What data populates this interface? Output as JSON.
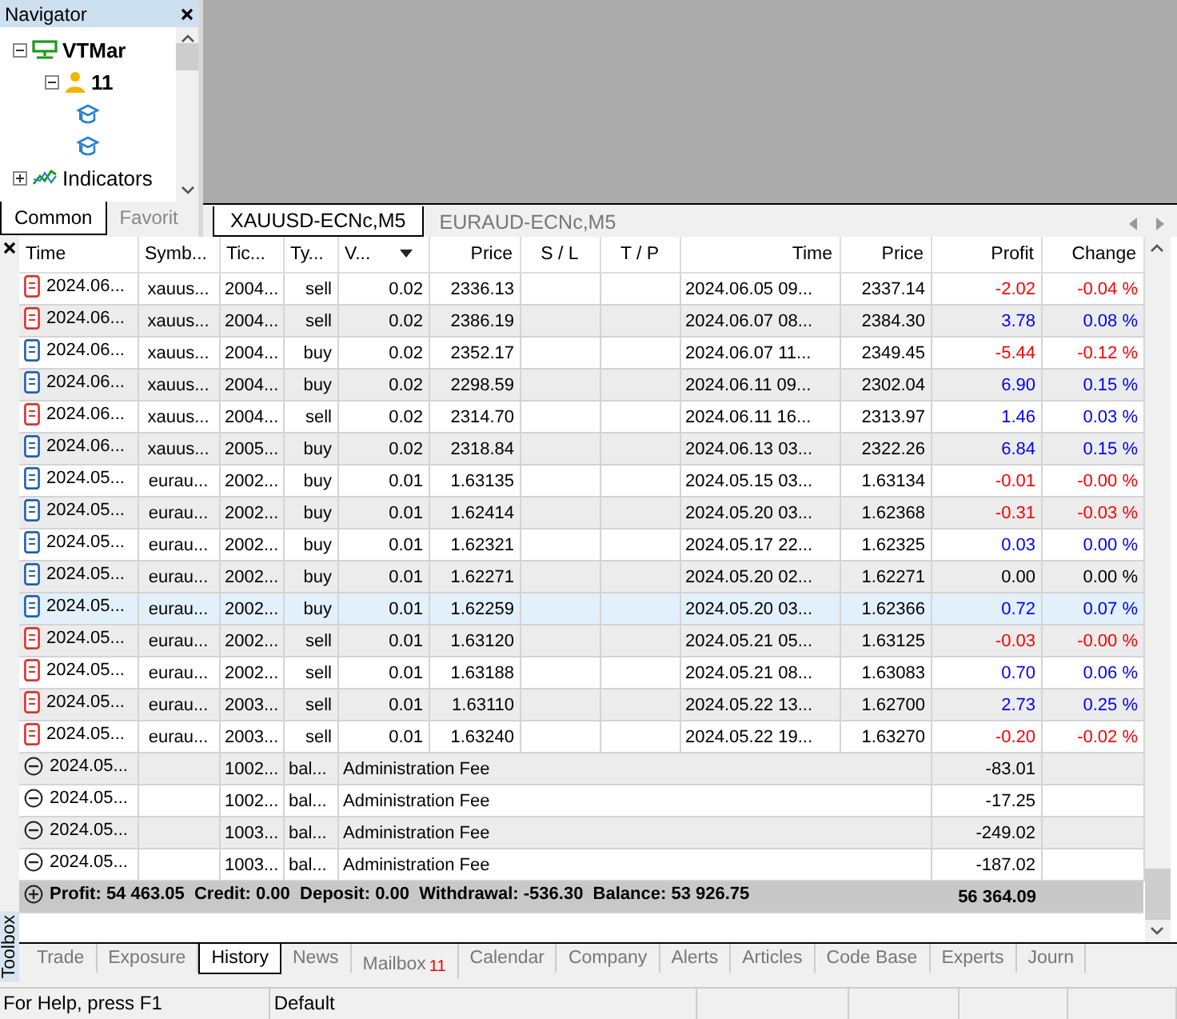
{
  "navigator": {
    "title": "Navigator",
    "tree": [
      {
        "label": "VTMar",
        "kind": "server",
        "expanded": true,
        "children": [
          {
            "label": "11",
            "kind": "account",
            "expanded": true,
            "children": [
              {
                "kind": "expert"
              },
              {
                "kind": "expert"
              }
            ]
          }
        ]
      },
      {
        "label": "Indicators",
        "kind": "indicators",
        "expanded": false
      }
    ],
    "tabs": [
      {
        "label": "Common",
        "selected": true
      },
      {
        "label": "Favorit",
        "selected": false
      }
    ]
  },
  "chart_tabs": [
    {
      "label": "XAUUSD-ECNc,M5",
      "selected": true
    },
    {
      "label": "EURAUD-ECNc,M5",
      "selected": false
    }
  ],
  "toolbox": {
    "label": "Toolbox",
    "columns": [
      {
        "label": "Time",
        "sorted": false
      },
      {
        "label": "Symb...",
        "sorted": false
      },
      {
        "label": "Tic...",
        "sorted": false
      },
      {
        "label": "Ty...",
        "sorted": false
      },
      {
        "label": "V...",
        "sorted": true
      },
      {
        "label": "Price",
        "sorted": false
      },
      {
        "label": "S / L",
        "sorted": false
      },
      {
        "label": "T / P",
        "sorted": false
      },
      {
        "label": "Time",
        "sorted": false
      },
      {
        "label": "Price",
        "sorted": false
      },
      {
        "label": "Profit",
        "sorted": false
      },
      {
        "label": "Change",
        "sorted": false
      }
    ],
    "rows": [
      {
        "kind": "sell",
        "selected": false,
        "time": "2024.06...",
        "symbol": "xauus...",
        "ticket": "2004...",
        "type": "sell",
        "volume": "0.02",
        "price": "2336.13",
        "close_time": "2024.06.05 09...",
        "close_price": "2337.14",
        "profit": "-2.02",
        "change": "-0.04 %",
        "color": "#ff0000"
      },
      {
        "kind": "sell",
        "selected": false,
        "time": "2024.06...",
        "symbol": "xauus...",
        "ticket": "2004...",
        "type": "sell",
        "volume": "0.02",
        "price": "2386.19",
        "close_time": "2024.06.07 08...",
        "close_price": "2384.30",
        "profit": "3.78",
        "change": "0.08 %",
        "color": "#0000ff"
      },
      {
        "kind": "buy",
        "selected": false,
        "time": "2024.06...",
        "symbol": "xauus...",
        "ticket": "2004...",
        "type": "buy",
        "volume": "0.02",
        "price": "2352.17",
        "close_time": "2024.06.07 11...",
        "close_price": "2349.45",
        "profit": "-5.44",
        "change": "-0.12 %",
        "color": "#ff0000"
      },
      {
        "kind": "buy",
        "selected": false,
        "time": "2024.06...",
        "symbol": "xauus...",
        "ticket": "2004...",
        "type": "buy",
        "volume": "0.02",
        "price": "2298.59",
        "close_time": "2024.06.11 09...",
        "close_price": "2302.04",
        "profit": "6.90",
        "change": "0.15 %",
        "color": "#0000ff"
      },
      {
        "kind": "sell",
        "selected": false,
        "time": "2024.06...",
        "symbol": "xauus...",
        "ticket": "2004...",
        "type": "sell",
        "volume": "0.02",
        "price": "2314.70",
        "close_time": "2024.06.11 16...",
        "close_price": "2313.97",
        "profit": "1.46",
        "change": "0.03 %",
        "color": "#0000ff"
      },
      {
        "kind": "buy",
        "selected": false,
        "time": "2024.06...",
        "symbol": "xauus...",
        "ticket": "2005...",
        "type": "buy",
        "volume": "0.02",
        "price": "2318.84",
        "close_time": "2024.06.13 03...",
        "close_price": "2322.26",
        "profit": "6.84",
        "change": "0.15 %",
        "color": "#0000ff"
      },
      {
        "kind": "buy",
        "selected": false,
        "time": "2024.05...",
        "symbol": "eurau...",
        "ticket": "2002...",
        "type": "buy",
        "volume": "0.01",
        "price": "1.63135",
        "close_time": "2024.05.15 03...",
        "close_price": "1.63134",
        "profit": "-0.01",
        "change": "-0.00 %",
        "color": "#ff0000"
      },
      {
        "kind": "buy",
        "selected": false,
        "time": "2024.05...",
        "symbol": "eurau...",
        "ticket": "2002...",
        "type": "buy",
        "volume": "0.01",
        "price": "1.62414",
        "close_time": "2024.05.20 03...",
        "close_price": "1.62368",
        "profit": "-0.31",
        "change": "-0.03 %",
        "color": "#ff0000"
      },
      {
        "kind": "buy",
        "selected": false,
        "time": "2024.05...",
        "symbol": "eurau...",
        "ticket": "2002...",
        "type": "buy",
        "volume": "0.01",
        "price": "1.62321",
        "close_time": "2024.05.17 22...",
        "close_price": "1.62325",
        "profit": "0.03",
        "change": "0.00 %",
        "color": "#0000ff"
      },
      {
        "kind": "buy",
        "selected": false,
        "time": "2024.05...",
        "symbol": "eurau...",
        "ticket": "2002...",
        "type": "buy",
        "volume": "0.01",
        "price": "1.62271",
        "close_time": "2024.05.20 02...",
        "close_price": "1.62271",
        "profit": "0.00",
        "change": "0.00 %",
        "color": "#000000"
      },
      {
        "kind": "buy",
        "selected": true,
        "time": "2024.05...",
        "symbol": "eurau...",
        "ticket": "2002...",
        "type": "buy",
        "volume": "0.01",
        "price": "1.62259",
        "close_time": "2024.05.20 03...",
        "close_price": "1.62366",
        "profit": "0.72",
        "change": "0.07 %",
        "color": "#0000ff"
      },
      {
        "kind": "sell",
        "selected": false,
        "time": "2024.05...",
        "symbol": "eurau...",
        "ticket": "2002...",
        "type": "sell",
        "volume": "0.01",
        "price": "1.63120",
        "close_time": "2024.05.21 05...",
        "close_price": "1.63125",
        "profit": "-0.03",
        "change": "-0.00 %",
        "color": "#ff0000"
      },
      {
        "kind": "sell",
        "selected": false,
        "time": "2024.05...",
        "symbol": "eurau...",
        "ticket": "2002...",
        "type": "sell",
        "volume": "0.01",
        "price": "1.63188",
        "close_time": "2024.05.21 08...",
        "close_price": "1.63083",
        "profit": "0.70",
        "change": "0.06 %",
        "color": "#0000ff"
      },
      {
        "kind": "sell",
        "selected": false,
        "time": "2024.05...",
        "symbol": "eurau...",
        "ticket": "2003...",
        "type": "sell",
        "volume": "0.01",
        "price": "1.63110",
        "close_time": "2024.05.22 13...",
        "close_price": "1.62700",
        "profit": "2.73",
        "change": "0.25 %",
        "color": "#0000ff"
      },
      {
        "kind": "sell",
        "selected": false,
        "time": "2024.05...",
        "symbol": "eurau...",
        "ticket": "2003...",
        "type": "sell",
        "volume": "0.01",
        "price": "1.63240",
        "close_time": "2024.05.22 19...",
        "close_price": "1.63270",
        "profit": "-0.20",
        "change": "-0.02 %",
        "color": "#ff0000"
      },
      {
        "kind": "balance",
        "selected": false,
        "time": "2024.05...",
        "ticket": "1002...",
        "type": "bal...",
        "comment": "Administration Fee",
        "profit": "-83.01"
      },
      {
        "kind": "balance",
        "selected": false,
        "time": "2024.05...",
        "ticket": "1002...",
        "type": "bal...",
        "comment": "Administration Fee",
        "profit": "-17.25"
      },
      {
        "kind": "balance",
        "selected": false,
        "time": "2024.05...",
        "ticket": "1003...",
        "type": "bal...",
        "comment": "Administration Fee",
        "profit": "-249.02"
      },
      {
        "kind": "balance",
        "selected": false,
        "time": "2024.05...",
        "ticket": "1003...",
        "type": "bal...",
        "comment": "Administration Fee",
        "profit": "-187.02"
      }
    ],
    "summary": {
      "text": "Profit: 54 463.05  Credit: 0.00  Deposit: 0.00  Withdrawal: -536.30  Balance: 53 926.75",
      "total": "56 364.09"
    },
    "tabs": [
      {
        "label": "Trade",
        "selected": false
      },
      {
        "label": "Exposure",
        "selected": false
      },
      {
        "label": "History",
        "selected": true
      },
      {
        "label": "News",
        "selected": false
      },
      {
        "label": "Mailbox",
        "badge": "11",
        "selected": false
      },
      {
        "label": "Calendar",
        "selected": false
      },
      {
        "label": "Company",
        "selected": false
      },
      {
        "label": "Alerts",
        "selected": false
      },
      {
        "label": "Articles",
        "selected": false
      },
      {
        "label": "Code Base",
        "selected": false
      },
      {
        "label": "Experts",
        "selected": false
      },
      {
        "label": "Journ",
        "selected": false
      }
    ]
  },
  "status_bar": [
    "For Help, press F1",
    "Default"
  ]
}
